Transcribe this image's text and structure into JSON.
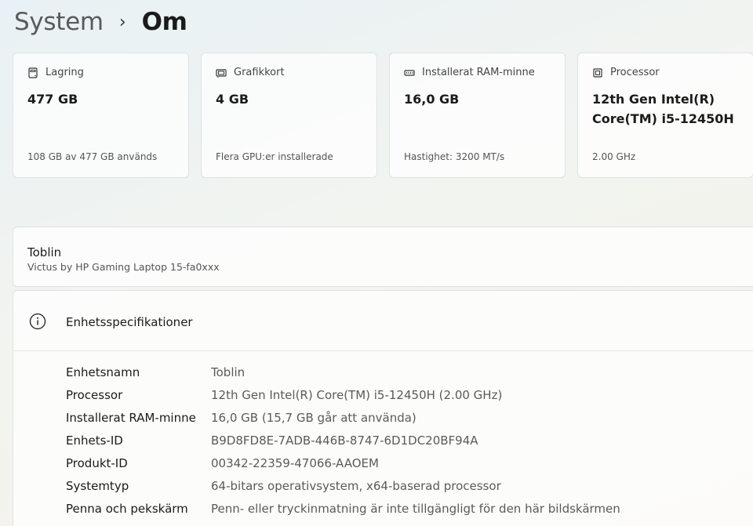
{
  "breadcrumb": {
    "parent": "System",
    "current": "Om"
  },
  "cards": [
    {
      "icon": "storage-icon",
      "label": "Lagring",
      "value": "477 GB",
      "sub": "108 GB av 477 GB används"
    },
    {
      "icon": "graphics-card-icon",
      "label": "Grafikkort",
      "value": "4 GB",
      "sub": "Flera GPU:er installerade"
    },
    {
      "icon": "ram-icon",
      "label": "Installerat RAM-minne",
      "value": "16,0 GB",
      "sub": "Hastighet: 3200 MT/s"
    },
    {
      "icon": "processor-icon",
      "label": "Processor",
      "value": "12th Gen Intel(R) Core(TM) i5-12450H",
      "sub": "2.00 GHz"
    }
  ],
  "device": {
    "name": "Toblin",
    "model": "Victus by HP Gaming Laptop 15-fa0xxx"
  },
  "specs": {
    "icon": "info-icon",
    "title": "Enhetsspecifikationer",
    "rows": [
      {
        "key": "Enhetsnamn",
        "value": "Toblin"
      },
      {
        "key": "Processor",
        "value": "12th Gen Intel(R) Core(TM) i5-12450H (2.00 GHz)"
      },
      {
        "key": "Installerat RAM-minne",
        "value": "16,0 GB (15,7 GB går att använda)"
      },
      {
        "key": "Enhets-ID",
        "value": "B9D8FD8E-7ADB-446B-8747-6D1DC20BF94A"
      },
      {
        "key": "Produkt-ID",
        "value": "00342-22359-47066-AAOEM"
      },
      {
        "key": "Systemtyp",
        "value": "64-bitars operativsystem, x64-baserad processor"
      },
      {
        "key": "Penna och pekskärm",
        "value": "Penn- eller tryckinmatning är inte tillgängligt för den här bildskärmen"
      }
    ]
  }
}
